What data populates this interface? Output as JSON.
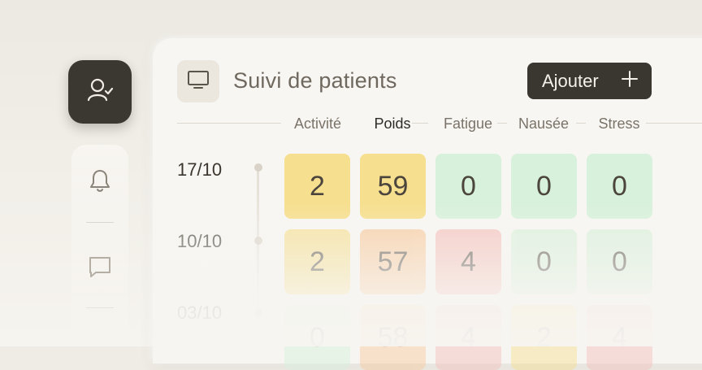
{
  "header": {
    "title": "Suivi de patients",
    "add_label": "Ajouter",
    "add_icon": "plus-icon",
    "view_icon": "monitor-icon"
  },
  "sidebar": {
    "items": [
      {
        "icon": "user-check-icon",
        "active": true
      },
      {
        "icon": "bell-icon",
        "active": false
      },
      {
        "icon": "message-icon",
        "active": false
      }
    ]
  },
  "columns": [
    "Activité",
    "Poids",
    "Fatigue",
    "Nausée",
    "Stress"
  ],
  "active_column": "Poids",
  "rows": [
    {
      "date": "17/10",
      "values": [
        "2",
        "59",
        "0",
        "0",
        "0"
      ]
    },
    {
      "date": "10/10",
      "values": [
        "2",
        "57",
        "4",
        "0",
        "0"
      ]
    },
    {
      "date": "03/10",
      "values": [
        "0",
        "58",
        "4",
        "2",
        "4"
      ]
    }
  ],
  "colors": {
    "yellow": "#f6df8f",
    "orange": "#f7c99c",
    "green": "#d8f1dc",
    "red": "#f6c0bb",
    "dark": "#3a3630"
  }
}
